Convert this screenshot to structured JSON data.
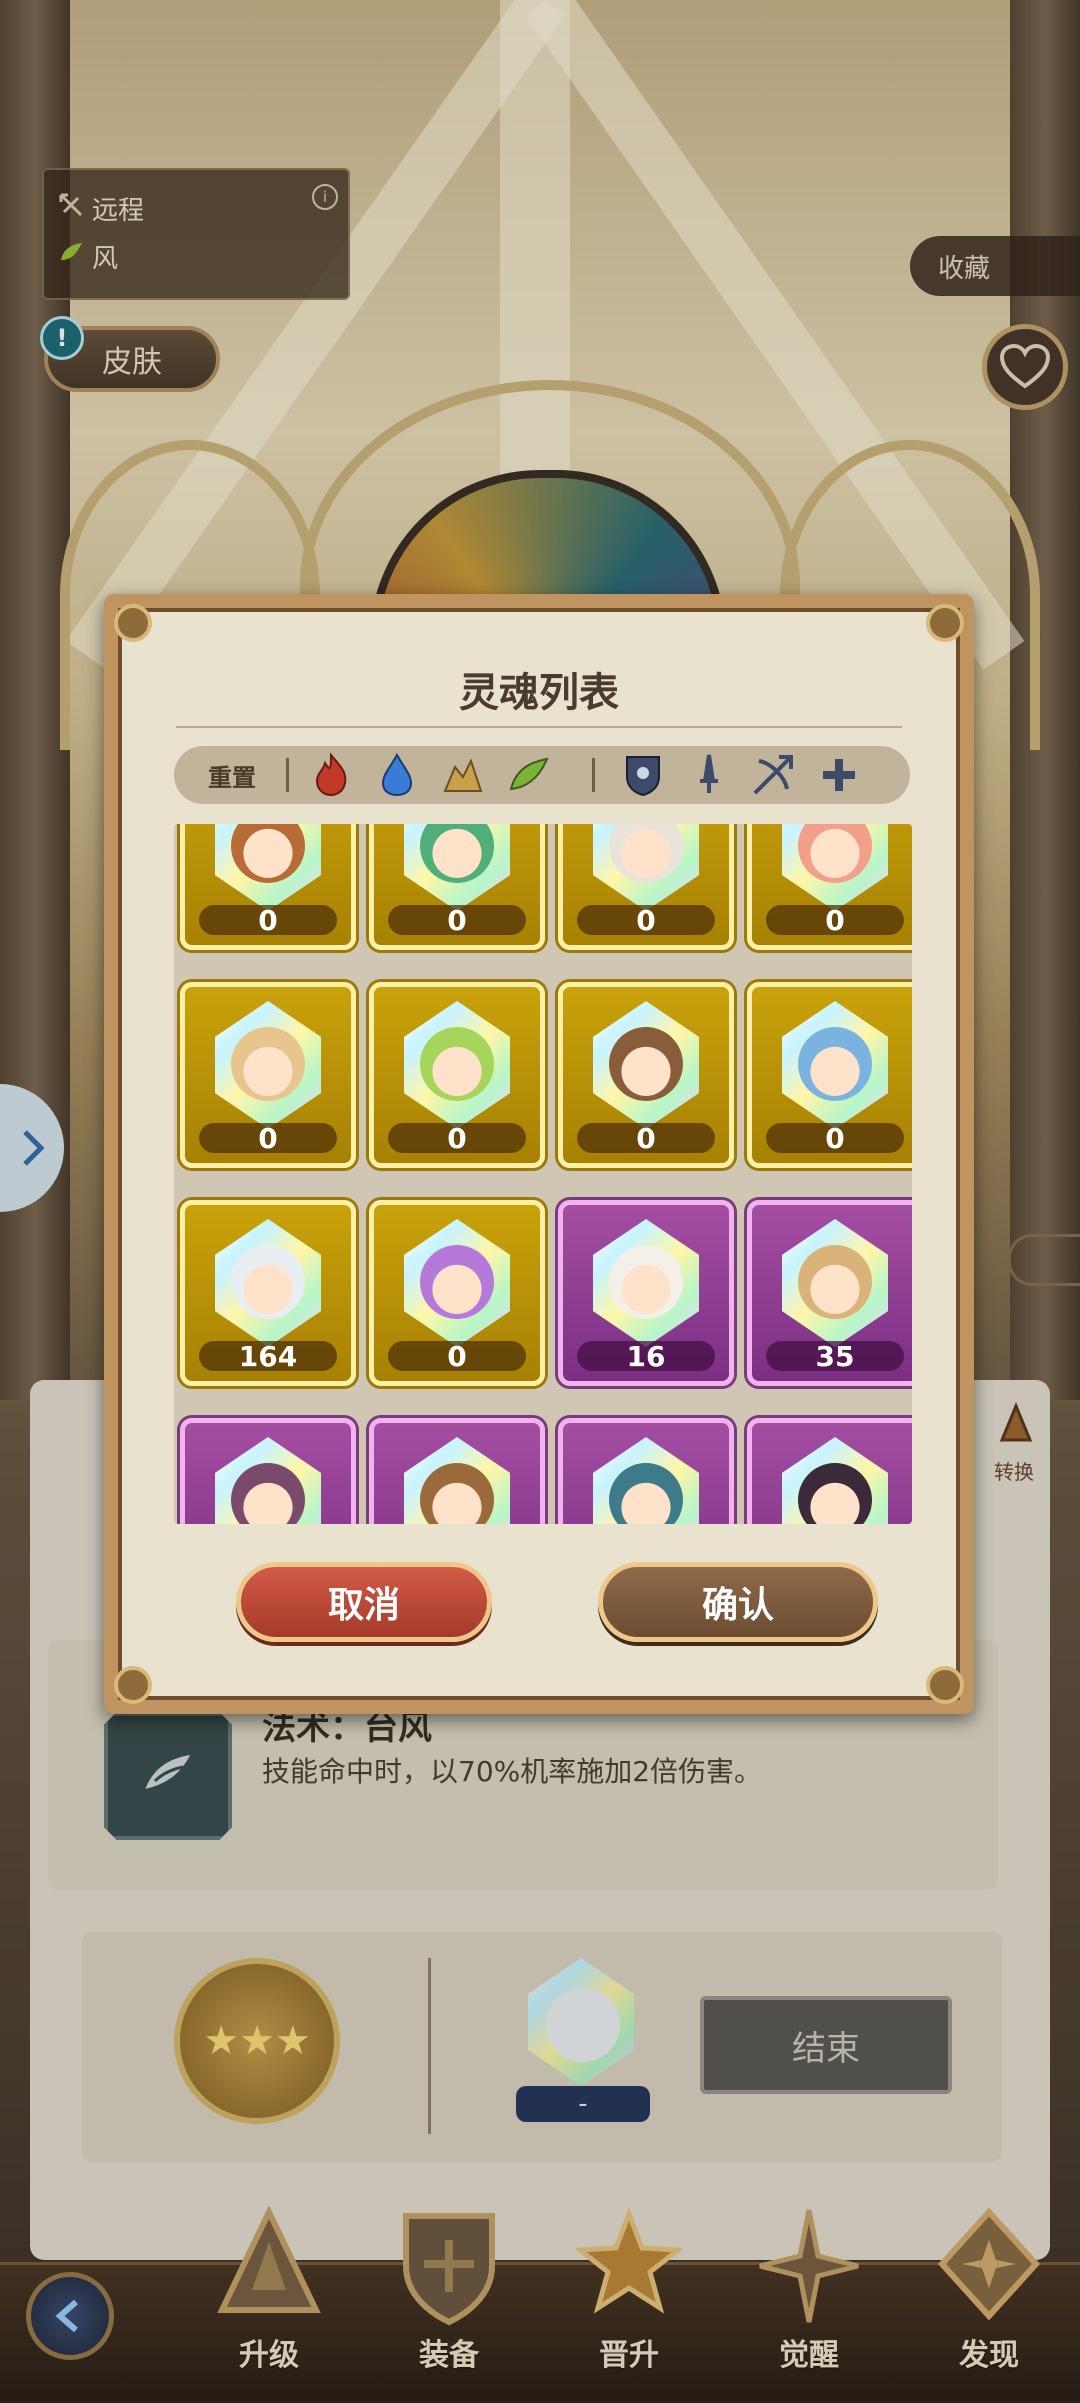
{
  "info": {
    "attack_type": "远程",
    "element": "风"
  },
  "skin_button": "皮肤",
  "collect_button": "收藏",
  "modal": {
    "title": "灵魂列表",
    "reset_label": "重置",
    "filter_icons": [
      "fire-icon",
      "water-icon",
      "earth-icon",
      "wind-icon",
      "tank-icon",
      "sword-icon",
      "bow-icon",
      "plus-icon"
    ],
    "cancel_label": "取消",
    "confirm_label": "确认"
  },
  "souls": [
    {
      "count": "0",
      "rarity": "gold",
      "color": "#b86b35"
    },
    {
      "count": "0",
      "rarity": "gold",
      "color": "#4fae7a"
    },
    {
      "count": "0",
      "rarity": "gold",
      "color": "#e9e4da"
    },
    {
      "count": "0",
      "rarity": "gold",
      "color": "#f2a08a"
    },
    {
      "count": "0",
      "rarity": "gold",
      "color": "#e7c58c"
    },
    {
      "count": "0",
      "rarity": "gold",
      "color": "#a6d55c"
    },
    {
      "count": "0",
      "rarity": "gold",
      "color": "#8a5d3a"
    },
    {
      "count": "0",
      "rarity": "gold",
      "color": "#7ab3e0"
    },
    {
      "count": "164",
      "rarity": "gold",
      "color": "#e9eef2"
    },
    {
      "count": "0",
      "rarity": "gold",
      "color": "#b57ad9"
    },
    {
      "count": "16",
      "rarity": "purple",
      "color": "#f3f0ea"
    },
    {
      "count": "35",
      "rarity": "purple",
      "color": "#d9b37a"
    },
    {
      "count": "",
      "rarity": "purple",
      "color": "#7a4a6a"
    },
    {
      "count": "",
      "rarity": "purple",
      "color": "#9a6a3a"
    },
    {
      "count": "",
      "rarity": "purple",
      "color": "#3d7a8a"
    },
    {
      "count": "",
      "rarity": "purple",
      "color": "#3a2a3a"
    }
  ],
  "spell": {
    "title": "法术：台风",
    "description": "技能命中时，以70%机率施加2倍伤害。"
  },
  "selected_soul_label": "-",
  "end_button": "结束",
  "side_swap": "转换",
  "nav": [
    {
      "label": "升级",
      "icon": "upgrade-icon"
    },
    {
      "label": "装备",
      "icon": "equipment-icon"
    },
    {
      "label": "晋升",
      "icon": "promote-icon"
    },
    {
      "label": "觉醒",
      "icon": "awaken-icon"
    },
    {
      "label": "发现",
      "icon": "discover-icon"
    }
  ],
  "colors": {
    "gold_card": "#c9a20b",
    "purple_card": "#a44ea2",
    "cancel": "#d25b45",
    "confirm": "#8f6a49"
  }
}
